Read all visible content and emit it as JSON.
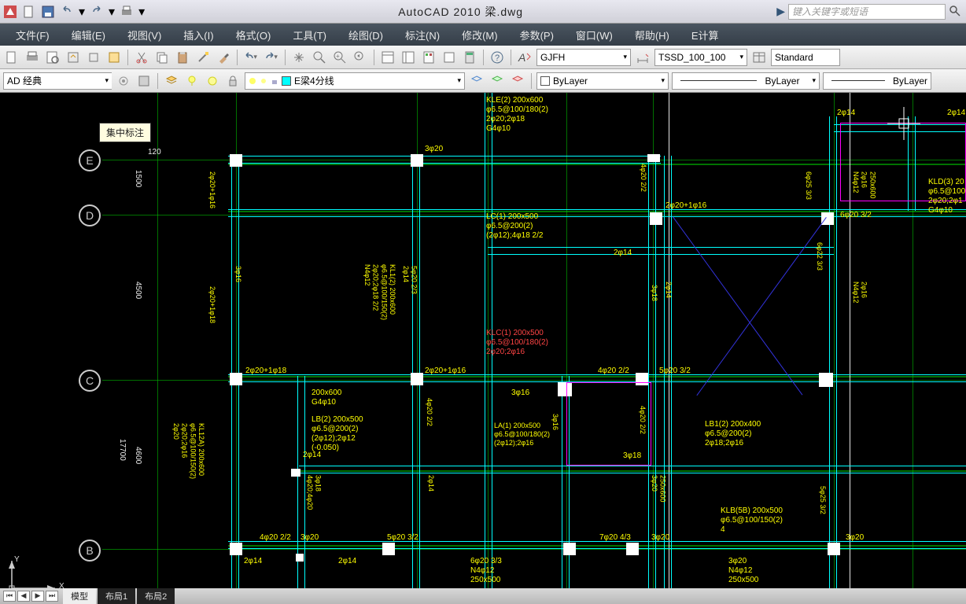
{
  "app": {
    "title": "AutoCAD 2010     梁.dwg"
  },
  "search": {
    "placeholder": "键入关键字或短语"
  },
  "menu": {
    "file": "文件(F)",
    "edit": "编辑(E)",
    "view": "视图(V)",
    "insert": "插入(I)",
    "format": "格式(O)",
    "tools": "工具(T)",
    "draw": "绘图(D)",
    "dim": "标注(N)",
    "modify": "修改(M)",
    "param": "参数(P)",
    "window": "窗口(W)",
    "help": "帮助(H)",
    "ecalc": "E计算"
  },
  "toolbar": {
    "textStyle": "GJFH",
    "dimStyle": "TSSD_100_100",
    "tableStyle": "Standard"
  },
  "workspace": "AD 经典",
  "layer": {
    "current": "E梁4分线",
    "bylayer": "ByLayer"
  },
  "tooltip": "集中标注",
  "bubbles": {
    "E": "E",
    "D": "D",
    "C": "C",
    "B": "B"
  },
  "dims": {
    "d1500": "1500",
    "d4500": "4500",
    "d4600": "4600",
    "d17700": "17700",
    "d120": "120"
  },
  "labels": {
    "kle2": "KLE(2) 200x600\nφ6.5@100/180(2)\n2φ20;2φ18\nG4φ10",
    "lc1": "LC(1) 200x500\nφ6.5@200(2)\n(2φ12);4φ18 2/2",
    "kld3": "KLD(3) 20\nφ6.5@100\n2φ20;2φ1\nG4φ10",
    "klc1": "KLC(1) 200x500\nφ6.5@100/180(2)\n2φ20;2φ16",
    "lb2": "LB(2) 200x500\nφ6.5@200(2)\n(2φ12);2φ12\n(-0.050)",
    "la1": "LA(1) 200x500\nφ6.5@100/180(2)\n(2φ12);2φ16",
    "lb1": "LB1(2) 200x400\nφ6.5@200(2)\n2φ18;2φ16",
    "klb5b": "KLB(5B) 200x500\nφ6.5@100/150(2)\n4",
    "kl12a": "KL12A) 200x600\nφ6.5@100/150(2)\n2φ20;2φ16\n2φ20",
    "kl12": "KL1(2) 200x600\nφ6.5@100/150(2)\n2φ20;2φ18 2/2\nN4φ12",
    "sec200x600": "200x600\nG4φ10"
  },
  "anno": {
    "a3b20": "3φ20",
    "a2b14": "2φ14",
    "a2b14b": "2φ14",
    "a3b16": "3φ16",
    "a2b20_1b16": "2φ20+1φ16",
    "a4b20_22": "4φ20 2/2",
    "a5b20_32": "5φ20 3/2",
    "a2b20_1b18": "2φ20+1φ18",
    "a2b20_1b16b": "2φ20+1φ16",
    "a4b20_22b": "4φ20 2/2",
    "a3b20b": "3φ20",
    "a5b20_32b": "5φ20 3/2",
    "a7b20_43": "7φ20 4/3",
    "a3b20c": "3φ20",
    "a2b14c": "2φ14",
    "a2b14d": "2φ14",
    "a2b14e": "2φ14",
    "a6b20_33": "6φ20 3/3\nN4φ12\n250x500",
    "a3b20d": "3φ20\nN4φ12\n250x500",
    "a6b20_32": "6φ20 3/2",
    "v3b16": "3φ16",
    "v5b20_23": "5φ20 2/3\n2φ14",
    "v4b20_22": "4φ20 2/2",
    "v3b18": "3φ18",
    "v3b18b": "3φ18\n4φ20;4φ20",
    "v6b25_33": "6φ25 3/3",
    "v6b22_33": "6φ22 3/3",
    "v5b25_32": "5φ25 3/2",
    "v2b16_n4b12": "2φ16\nN4φ12",
    "v2b16_250x600": "250x600\n2φ16\nN4φ12",
    "v3b20_250x600": "250x600\n3φ20",
    "a3b18_u": "3φ18",
    "a3b16_u": "3φ16",
    "a3b20e": "3φ20"
  },
  "tabs": {
    "model": "模型",
    "layout1": "布局1",
    "layout2": "布局2"
  },
  "ucs": {
    "x": "X",
    "y": "Y"
  }
}
